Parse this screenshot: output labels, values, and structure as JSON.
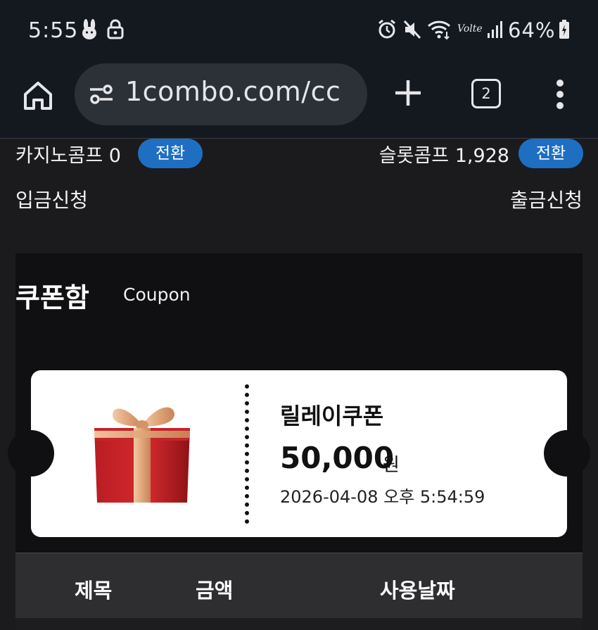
{
  "status_bar": {
    "time": "5:55",
    "battery": "64%",
    "icons": [
      "bunny-icon",
      "lock-icon",
      "alarm-icon",
      "mute-icon",
      "wifi-icon",
      "volte-icon",
      "signal-icon",
      "battery-icon"
    ],
    "volte_label": "Volte"
  },
  "browser": {
    "url": "1combo.com/cc",
    "tab_count": "2"
  },
  "comp": {
    "casino_label": "카지노콤프 0",
    "casino_convert": "전환",
    "slot_label": "슬롯콤프 1,928",
    "slot_convert": "전환"
  },
  "links": {
    "deposit": "입금신청",
    "withdraw": "출금신청"
  },
  "coupon": {
    "title": "쿠폰함",
    "subtitle": "Coupon",
    "ticket": {
      "name": "릴레이쿠폰",
      "amount": "50,000",
      "unit": "원",
      "date": "2026-04-08 오후 5:54:59"
    },
    "table_headers": [
      "제목",
      "금액",
      "사용날짜"
    ]
  },
  "colors": {
    "accent_pill": "#1e6fc2",
    "bar_bg": "#141920",
    "panel_bg": "#101012"
  }
}
